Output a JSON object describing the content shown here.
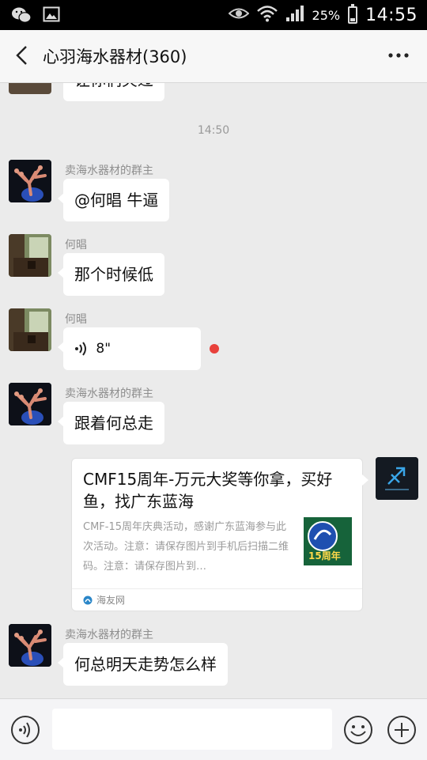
{
  "status_bar": {
    "battery_text": "25%",
    "battery_level": 0.25,
    "time": "14:55",
    "icons": [
      "wechat-icon",
      "image-icon",
      "eye-icon",
      "wifi-icon",
      "signal-icon",
      "battery-icon"
    ]
  },
  "header": {
    "title": "心羽海水器材(360)",
    "back_icon": "chevron-left-icon",
    "more_icon": "more-dots-icon"
  },
  "chat": {
    "partial_top_text": "让你们夹过",
    "time_divider": "14:50",
    "messages": [
      {
        "sender": "卖海水器材的群主",
        "avatar": "coral-avatar",
        "text": "@何晿  牛逼"
      },
      {
        "sender": "何晿",
        "avatar": "room-avatar",
        "text": "那个时候低"
      },
      {
        "sender": "何晿",
        "avatar": "room-avatar",
        "voice_duration": "8\"",
        "unread": true
      },
      {
        "sender": "卖海水器材的群主",
        "avatar": "coral-avatar",
        "text": "跟着何总走"
      },
      {
        "sender": "卖海水器材的群主",
        "avatar": "coral-avatar",
        "text": "何总明天走势怎么样"
      }
    ],
    "link_card": {
      "title": "CMF15周年-万元大奖等你拿，买好鱼，找广东蓝海",
      "description": "CMF-15周年庆典活动，感谢广东蓝海参与此次活动。注意：请保存图片到手机后扫描二维码。注意：请保存图片到…",
      "thumb_text": "15周年",
      "source": "海友网"
    }
  },
  "input_bar": {
    "placeholder": "",
    "value": "",
    "icons": [
      "voice-icon",
      "emoji-icon",
      "plus-icon"
    ]
  },
  "colors": {
    "chat_background": "#ebebeb",
    "bubble": "#ffffff",
    "unread_dot": "#e8413b",
    "status_bar": "#000000"
  }
}
